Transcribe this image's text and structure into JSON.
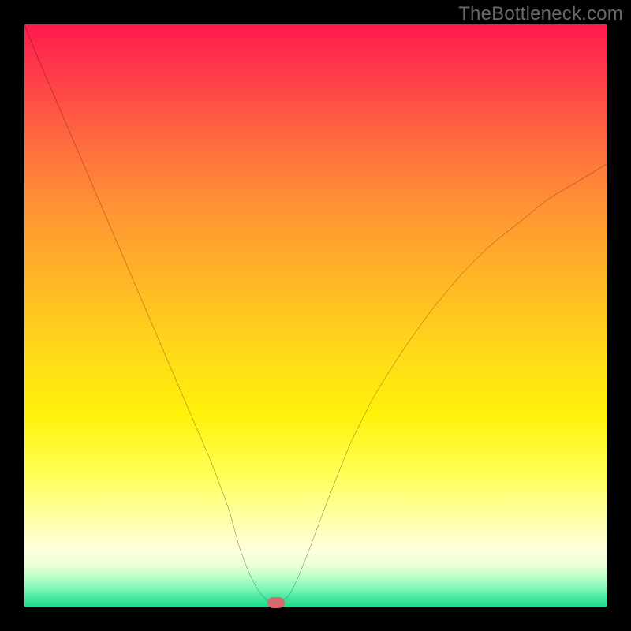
{
  "watermark": "TheBottleneck.com",
  "chart_data": {
    "type": "line",
    "title": "",
    "xlabel": "",
    "ylabel": "",
    "xlim": [
      0,
      100
    ],
    "ylim": [
      0,
      100
    ],
    "series": [
      {
        "name": "bottleneck-curve",
        "x": [
          0,
          2,
          5,
          8,
          11,
          14,
          17,
          20,
          23,
          26,
          29,
          32,
          35,
          37,
          38.5,
          40,
          41.5,
          42.5,
          43,
          44,
          45.5,
          47,
          49,
          52,
          56,
          60,
          65,
          70,
          75,
          80,
          85,
          90,
          95,
          100
        ],
        "y": [
          100,
          95,
          88,
          81,
          74,
          67,
          60,
          53,
          46,
          39,
          32,
          25,
          17,
          10,
          6,
          3,
          1.2,
          0.7,
          0.7,
          0.8,
          2,
          5,
          10,
          18,
          28,
          36,
          44,
          51,
          57,
          62,
          66,
          70,
          73,
          76
        ]
      }
    ],
    "marker": {
      "x": 43.2,
      "y": 0.7
    },
    "gradient_stops": [
      {
        "pos": 0,
        "color": "#ff1a4d"
      },
      {
        "pos": 50,
        "color": "#ffd61a"
      },
      {
        "pos": 90,
        "color": "#ffffdc"
      },
      {
        "pos": 100,
        "color": "#1fd98c"
      }
    ]
  }
}
